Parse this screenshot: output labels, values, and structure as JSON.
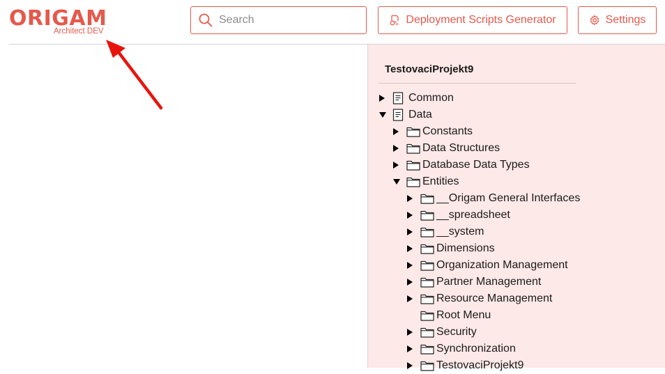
{
  "header": {
    "logo_text": "ORIGAM",
    "logo_subtitle": "Architect DEV",
    "search_placeholder": "Search",
    "deploy_label": "Deployment Scripts Generator",
    "settings_label": "Settings"
  },
  "colors": {
    "accent": "#e5594b",
    "panel_bg": "#fde9e7",
    "annotation": "#e8140c"
  },
  "tree": {
    "project": "TestovaciProjekt9",
    "items": [
      {
        "label": "Common",
        "depth": 0,
        "toggle": "collapsed",
        "icon": "document-icon"
      },
      {
        "label": "Data",
        "depth": 0,
        "toggle": "expanded",
        "icon": "document-icon"
      },
      {
        "label": "Constants",
        "depth": 1,
        "toggle": "collapsed",
        "icon": "folder-icon"
      },
      {
        "label": "Data Structures",
        "depth": 1,
        "toggle": "collapsed",
        "icon": "folder-icon"
      },
      {
        "label": "Database Data Types",
        "depth": 1,
        "toggle": "collapsed",
        "icon": "folder-icon"
      },
      {
        "label": "Entities",
        "depth": 1,
        "toggle": "expanded",
        "icon": "folder-icon"
      },
      {
        "label": "__Origam General Interfaces",
        "depth": 2,
        "toggle": "collapsed",
        "icon": "folder-icon"
      },
      {
        "label": "__spreadsheet",
        "depth": 2,
        "toggle": "collapsed",
        "icon": "folder-icon"
      },
      {
        "label": "__system",
        "depth": 2,
        "toggle": "collapsed",
        "icon": "folder-icon"
      },
      {
        "label": "Dimensions",
        "depth": 2,
        "toggle": "collapsed",
        "icon": "folder-icon"
      },
      {
        "label": "Organization Management",
        "depth": 2,
        "toggle": "collapsed",
        "icon": "folder-icon"
      },
      {
        "label": "Partner Management",
        "depth": 2,
        "toggle": "collapsed",
        "icon": "folder-icon"
      },
      {
        "label": "Resource Management",
        "depth": 2,
        "toggle": "collapsed",
        "icon": "folder-icon"
      },
      {
        "label": "Root Menu",
        "depth": 2,
        "toggle": "none",
        "icon": "folder-icon"
      },
      {
        "label": "Security",
        "depth": 2,
        "toggle": "collapsed",
        "icon": "folder-icon"
      },
      {
        "label": "Synchronization",
        "depth": 2,
        "toggle": "collapsed",
        "icon": "folder-icon"
      },
      {
        "label": "TestovaciProjekt9",
        "depth": 2,
        "toggle": "collapsed",
        "icon": "folder-icon"
      }
    ]
  }
}
